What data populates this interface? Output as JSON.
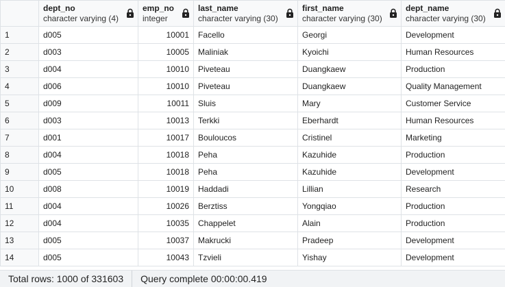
{
  "columns": [
    {
      "name": "dept_no",
      "type": "character varying (4)"
    },
    {
      "name": "emp_no",
      "type": "integer"
    },
    {
      "name": "last_name",
      "type": "character varying (30)"
    },
    {
      "name": "first_name",
      "type": "character varying (30)"
    },
    {
      "name": "dept_name",
      "type": "character varying (30)"
    }
  ],
  "rows": [
    {
      "n": "1",
      "dept_no": "d005",
      "emp_no": "10001",
      "last_name": "Facello",
      "first_name": "Georgi",
      "dept_name": "Development"
    },
    {
      "n": "2",
      "dept_no": "d003",
      "emp_no": "10005",
      "last_name": "Maliniak",
      "first_name": "Kyoichi",
      "dept_name": "Human Resources"
    },
    {
      "n": "3",
      "dept_no": "d004",
      "emp_no": "10010",
      "last_name": "Piveteau",
      "first_name": "Duangkaew",
      "dept_name": "Production"
    },
    {
      "n": "4",
      "dept_no": "d006",
      "emp_no": "10010",
      "last_name": "Piveteau",
      "first_name": "Duangkaew",
      "dept_name": "Quality Management"
    },
    {
      "n": "5",
      "dept_no": "d009",
      "emp_no": "10011",
      "last_name": "Sluis",
      "first_name": "Mary",
      "dept_name": "Customer Service"
    },
    {
      "n": "6",
      "dept_no": "d003",
      "emp_no": "10013",
      "last_name": "Terkki",
      "first_name": "Eberhardt",
      "dept_name": "Human Resources"
    },
    {
      "n": "7",
      "dept_no": "d001",
      "emp_no": "10017",
      "last_name": "Bouloucos",
      "first_name": "Cristinel",
      "dept_name": "Marketing"
    },
    {
      "n": "8",
      "dept_no": "d004",
      "emp_no": "10018",
      "last_name": "Peha",
      "first_name": "Kazuhide",
      "dept_name": "Production"
    },
    {
      "n": "9",
      "dept_no": "d005",
      "emp_no": "10018",
      "last_name": "Peha",
      "first_name": "Kazuhide",
      "dept_name": "Development"
    },
    {
      "n": "10",
      "dept_no": "d008",
      "emp_no": "10019",
      "last_name": "Haddadi",
      "first_name": "Lillian",
      "dept_name": "Research"
    },
    {
      "n": "11",
      "dept_no": "d004",
      "emp_no": "10026",
      "last_name": "Berztiss",
      "first_name": "Yongqiao",
      "dept_name": "Production"
    },
    {
      "n": "12",
      "dept_no": "d004",
      "emp_no": "10035",
      "last_name": "Chappelet",
      "first_name": "Alain",
      "dept_name": "Production"
    },
    {
      "n": "13",
      "dept_no": "d005",
      "emp_no": "10037",
      "last_name": "Makrucki",
      "first_name": "Pradeep",
      "dept_name": "Development"
    },
    {
      "n": "14",
      "dept_no": "d005",
      "emp_no": "10043",
      "last_name": "Tzvieli",
      "first_name": "Yishay",
      "dept_name": "Development"
    }
  ],
  "status": {
    "total_rows": "Total rows: 1000 of 331603",
    "query_complete": "Query complete 00:00:00.419"
  },
  "icons": {
    "column_lock": "lock-icon"
  },
  "colors": {
    "header_bg": "#f8f9fa",
    "border": "#dee2e6",
    "statusbar_bg": "#f1f3f5"
  }
}
